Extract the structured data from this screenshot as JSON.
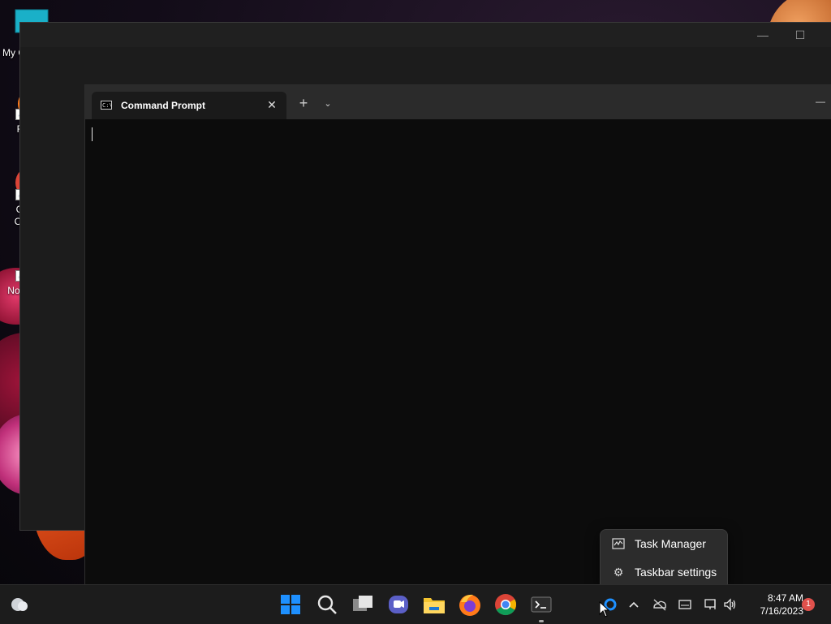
{
  "desktop": {
    "icons": [
      {
        "label": "My Computer",
        "icon": "computer-icon"
      },
      {
        "label": "Firefox",
        "icon": "firefox-icon"
      },
      {
        "label": "Google Chrome",
        "icon": "chrome-icon"
      },
      {
        "label": "Notepad++",
        "icon": "notepadpp-icon"
      }
    ]
  },
  "background_window": {
    "minimize_glyph": "—",
    "maximize_glyph": "☐"
  },
  "terminal": {
    "tab_title": "Command Prompt",
    "tab_icon_text": "C:\\",
    "close_glyph": "✕",
    "new_tab_glyph": "+",
    "dropdown_glyph": "⌄",
    "minimize_glyph": "—"
  },
  "context_menu": {
    "items": [
      {
        "label": "Task Manager",
        "icon": "task-manager-icon"
      },
      {
        "label": "Taskbar settings",
        "icon": "gear-icon"
      }
    ]
  },
  "taskbar": {
    "apps": [
      "start",
      "search",
      "task-view",
      "teams-chat",
      "file-explorer",
      "firefox",
      "chrome",
      "terminal"
    ],
    "clock": {
      "time": "8:47 AM",
      "date": "7/16/2023"
    },
    "notification_count": "1"
  },
  "colors": {
    "taskbar_bg": "#1c1c1c",
    "menu_bg": "#2c2c2c",
    "terminal_bg": "#0c0c0c",
    "accent": "#1e90ff"
  }
}
